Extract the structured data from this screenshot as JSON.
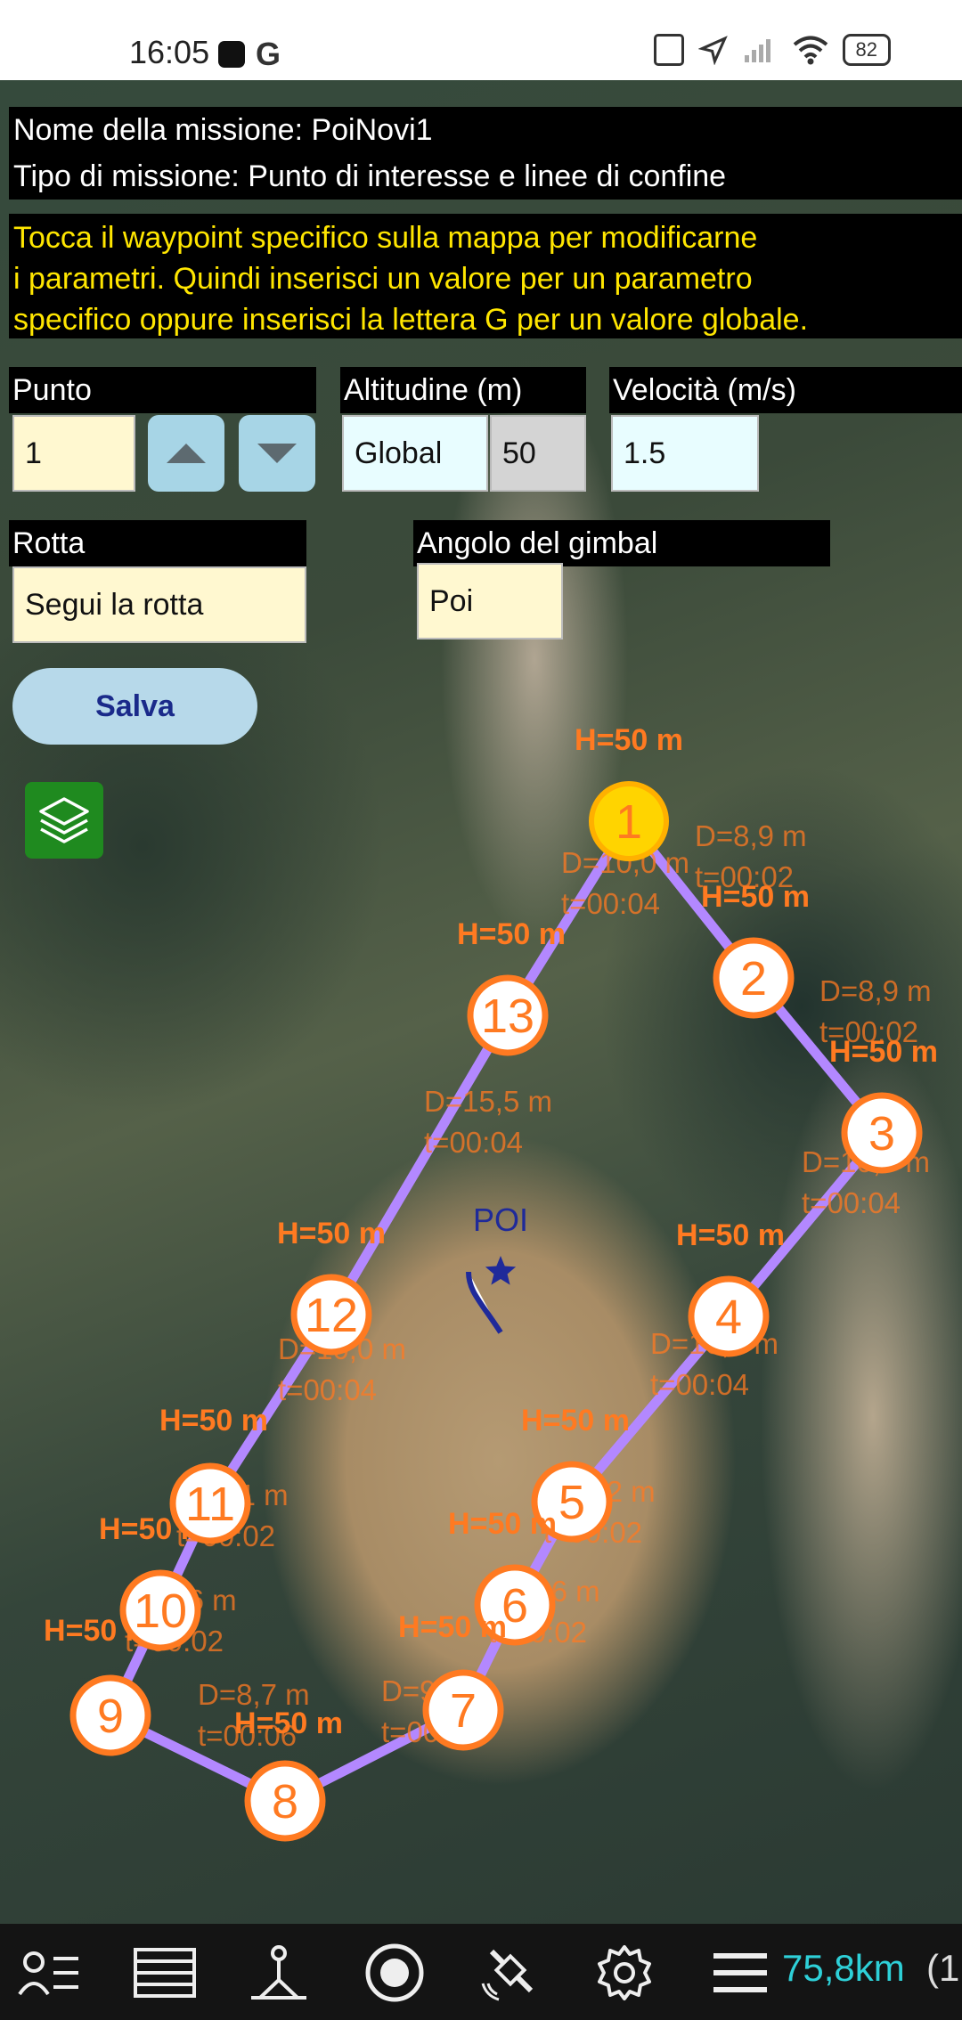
{
  "status_bar": {
    "time": "16:05",
    "battery": "82",
    "icons": [
      "app-notification-icon",
      "google-icon",
      "nfc-icon",
      "location-arrow-icon",
      "signal-off-icon",
      "wifi-icon",
      "battery-icon"
    ]
  },
  "mission": {
    "name_line": "Nome della missione: PoiNovi1",
    "type_line": "Tipo di missione: Punto di interesse e linee di confine",
    "instructions": [
      "Tocca il waypoint specifico sulla mappa per modificarne",
      "i parametri. Quindi inserisci un valore per un parametro",
      "specifico oppure inserisci la lettera G per un valore globale."
    ]
  },
  "form": {
    "point_label": "Punto",
    "point_value": "1",
    "altitude_label": "Altitudine (m)",
    "altitude_mode": "Global",
    "altitude_value": "50",
    "speed_label": "Velocità (m/s)",
    "speed_value": "1.5",
    "route_label": "Rotta",
    "route_value": "Segui la rotta",
    "gimbal_label": "Angolo del gimbal",
    "gimbal_value": "Poi",
    "save_label": "Salva"
  },
  "map": {
    "poi_label": "POI",
    "waypoints": [
      {
        "n": "1",
        "h": "H=50 m",
        "selected": true
      },
      {
        "n": "2",
        "h": "H=50 m"
      },
      {
        "n": "3",
        "h": "H=50 m"
      },
      {
        "n": "4",
        "h": "H=50 m"
      },
      {
        "n": "5",
        "h": "H=50 m"
      },
      {
        "n": "6",
        "h": "H=50 m"
      },
      {
        "n": "7",
        "h": "H=50 m"
      },
      {
        "n": "8",
        "h": "H=50 m"
      },
      {
        "n": "9",
        "h": "H=50 m"
      },
      {
        "n": "10",
        "h": "H=50 m"
      },
      {
        "n": "11",
        "h": "H=50 m"
      },
      {
        "n": "12",
        "h": "H=50 m"
      },
      {
        "n": "13",
        "h": "H=50 m"
      }
    ],
    "segments": [
      {
        "d": "D=8,9 m",
        "t": "t=00:02"
      },
      {
        "d": "D=8,9 m",
        "t": "t=00:02"
      },
      {
        "d": "D=10,6 m",
        "t": "t=00:04"
      },
      {
        "d": "D=10,6 m",
        "t": "t=00:04"
      },
      {
        "d": "D=5,2 m",
        "t": "t=00:02"
      },
      {
        "d": "D=5,6 m",
        "t": "t=00:02"
      },
      {
        "d": "D=9,0 m",
        "t": "t=00:06"
      },
      {
        "d": "D=8,7 m",
        "t": "t=00:06"
      },
      {
        "d": "D=5,6 m",
        "t": "t=00:02"
      },
      {
        "d": "D=5,1 m",
        "t": "t=00:02"
      },
      {
        "d": "D=10,0 m",
        "t": "t=00:04"
      },
      {
        "d": "D=15,5 m",
        "t": "t=00:04"
      },
      {
        "d": "D=10,0 m",
        "t": "t=00:04"
      }
    ],
    "colors": {
      "route": "#b388ff",
      "waypoint": "#ff7a21",
      "selected": "#ffd400",
      "poi": "#1f2a9a"
    }
  },
  "bottom_nav": {
    "icons": [
      "user-list-icon",
      "list-icon",
      "survey-icon",
      "record-icon",
      "satellite-icon",
      "settings-icon",
      "menu-icon"
    ],
    "distance": "75,8km",
    "extra": "(1"
  }
}
